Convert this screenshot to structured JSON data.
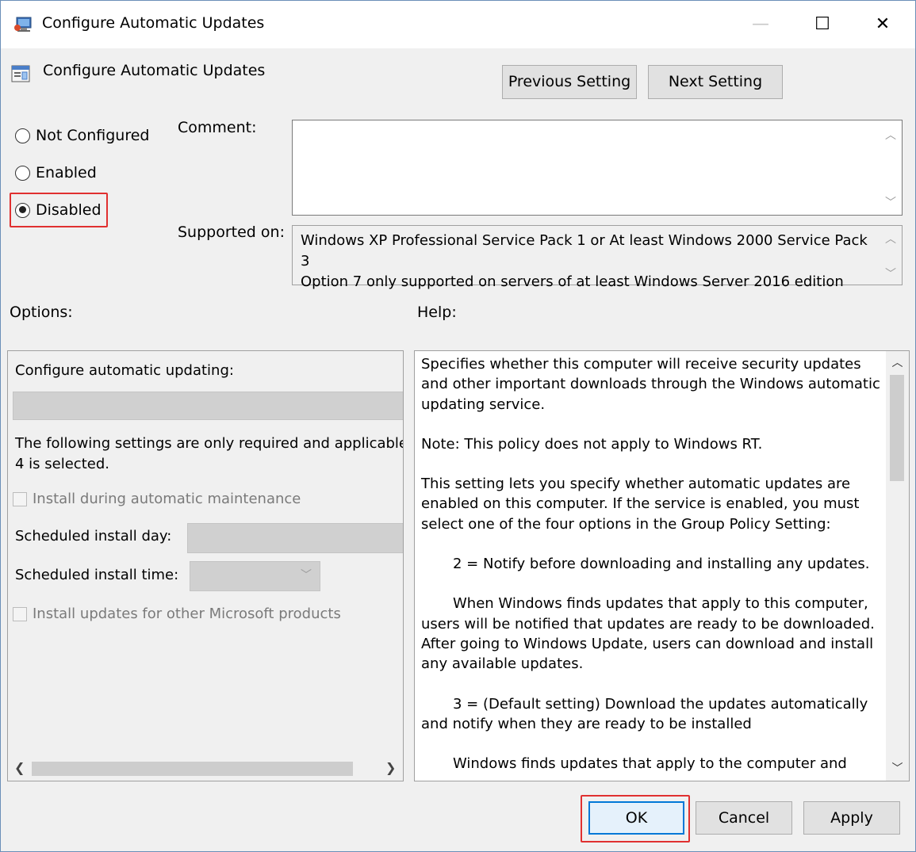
{
  "window": {
    "title": "Configure Automatic Updates",
    "minimize": "—",
    "maximize": "☐",
    "close": "✕"
  },
  "policy": {
    "name": "Configure Automatic Updates",
    "previous_label": "Previous Setting",
    "next_label": "Next Setting"
  },
  "state": {
    "options": [
      {
        "label": "Not Configured",
        "checked": false
      },
      {
        "label": "Enabled",
        "checked": false
      },
      {
        "label": "Disabled",
        "checked": true
      }
    ]
  },
  "comment": {
    "label": "Comment:",
    "value": ""
  },
  "supported": {
    "label": "Supported on:",
    "line1": "Windows XP Professional Service Pack 1 or At least Windows 2000 Service Pack 3",
    "line2": "Option 7 only supported on servers of at least Windows Server 2016 edition"
  },
  "options_panel": {
    "label": "Options:",
    "configure_label": "Configure automatic updating:",
    "note_line1": "The following settings are only required and applicable",
    "note_line2": "4 is selected.",
    "maintenance_label": "Install during automatic maintenance",
    "install_day_label": "Scheduled install day:",
    "install_time_label": "Scheduled install time:",
    "other_products_label": "Install updates for other Microsoft products"
  },
  "help": {
    "label": "Help:",
    "p1": "Specifies whether this computer will receive security updates and other important downloads through the Windows automatic updating service.",
    "p2": "Note: This policy does not apply to Windows RT.",
    "p3": "This setting lets you specify whether automatic updates are enabled on this computer. If the service is enabled, you must select one of the four options in the Group Policy Setting:",
    "p4": "2 = Notify before downloading and installing any updates.",
    "p5": "When Windows finds updates that apply to this computer, users will be notified that updates are ready to be downloaded. After going to Windows Update, users can download and install any available updates.",
    "p6": "3 = (Default setting) Download the updates automatically and notify when they are ready to be installed",
    "p7": "Windows finds updates that apply to the computer and"
  },
  "footer": {
    "ok_label": "OK",
    "cancel_label": "Cancel",
    "apply_label": "Apply"
  },
  "icons": {
    "app": "group-policy-icon",
    "policy": "policy-setting-icon",
    "highlight_color": "#e03030",
    "focus_color": "#0078d7"
  }
}
